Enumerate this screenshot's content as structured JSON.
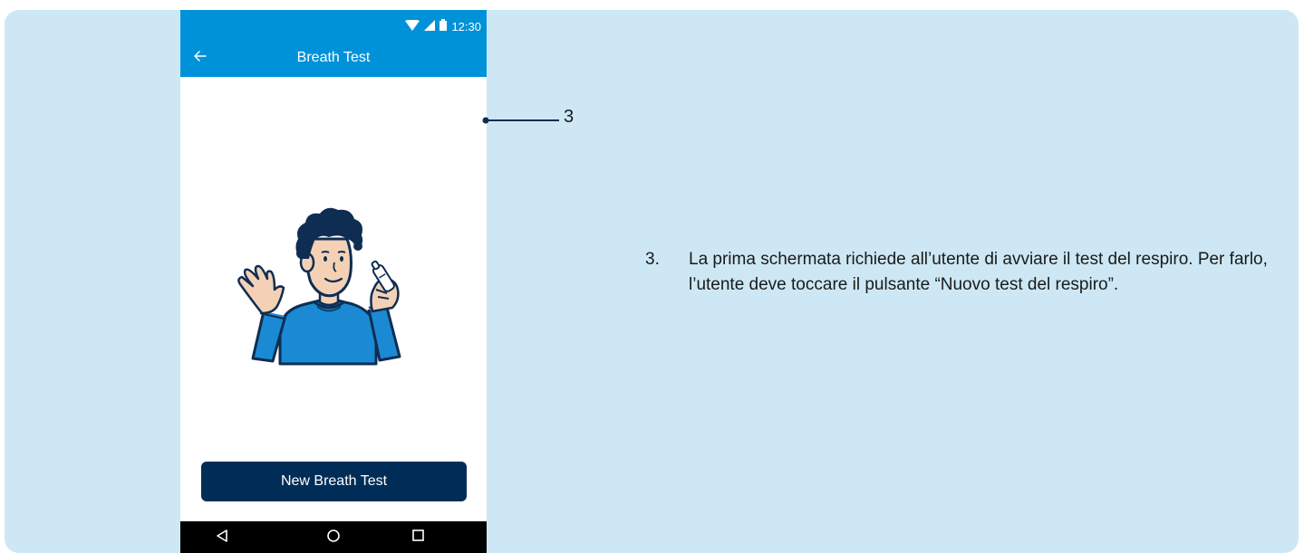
{
  "status_bar": {
    "time": "12:30",
    "icons": [
      "wifi-icon",
      "signal-icon",
      "battery-icon"
    ]
  },
  "app_bar": {
    "title": "Breath Test",
    "back_icon": "arrow-left-icon"
  },
  "main": {
    "button_label": "New Breath Test"
  },
  "nav_bar": {
    "icons": [
      "back-triangle-icon",
      "home-circle-icon",
      "recents-square-icon"
    ]
  },
  "callout": {
    "number": "3"
  },
  "description": {
    "number": "3.",
    "text": "La prima schermata richiede all’utente di avviare il test del respiro. Per farlo, l’utente deve toccare il pulsante “Nuovo test del respiro”."
  },
  "colors": {
    "panel_bg": "#cde8f4",
    "app_bar": "#0092d9",
    "button": "#002d57",
    "shirt": "#1a8ad4",
    "outline": "#0f2d52",
    "skin": "#f4d1b5"
  }
}
